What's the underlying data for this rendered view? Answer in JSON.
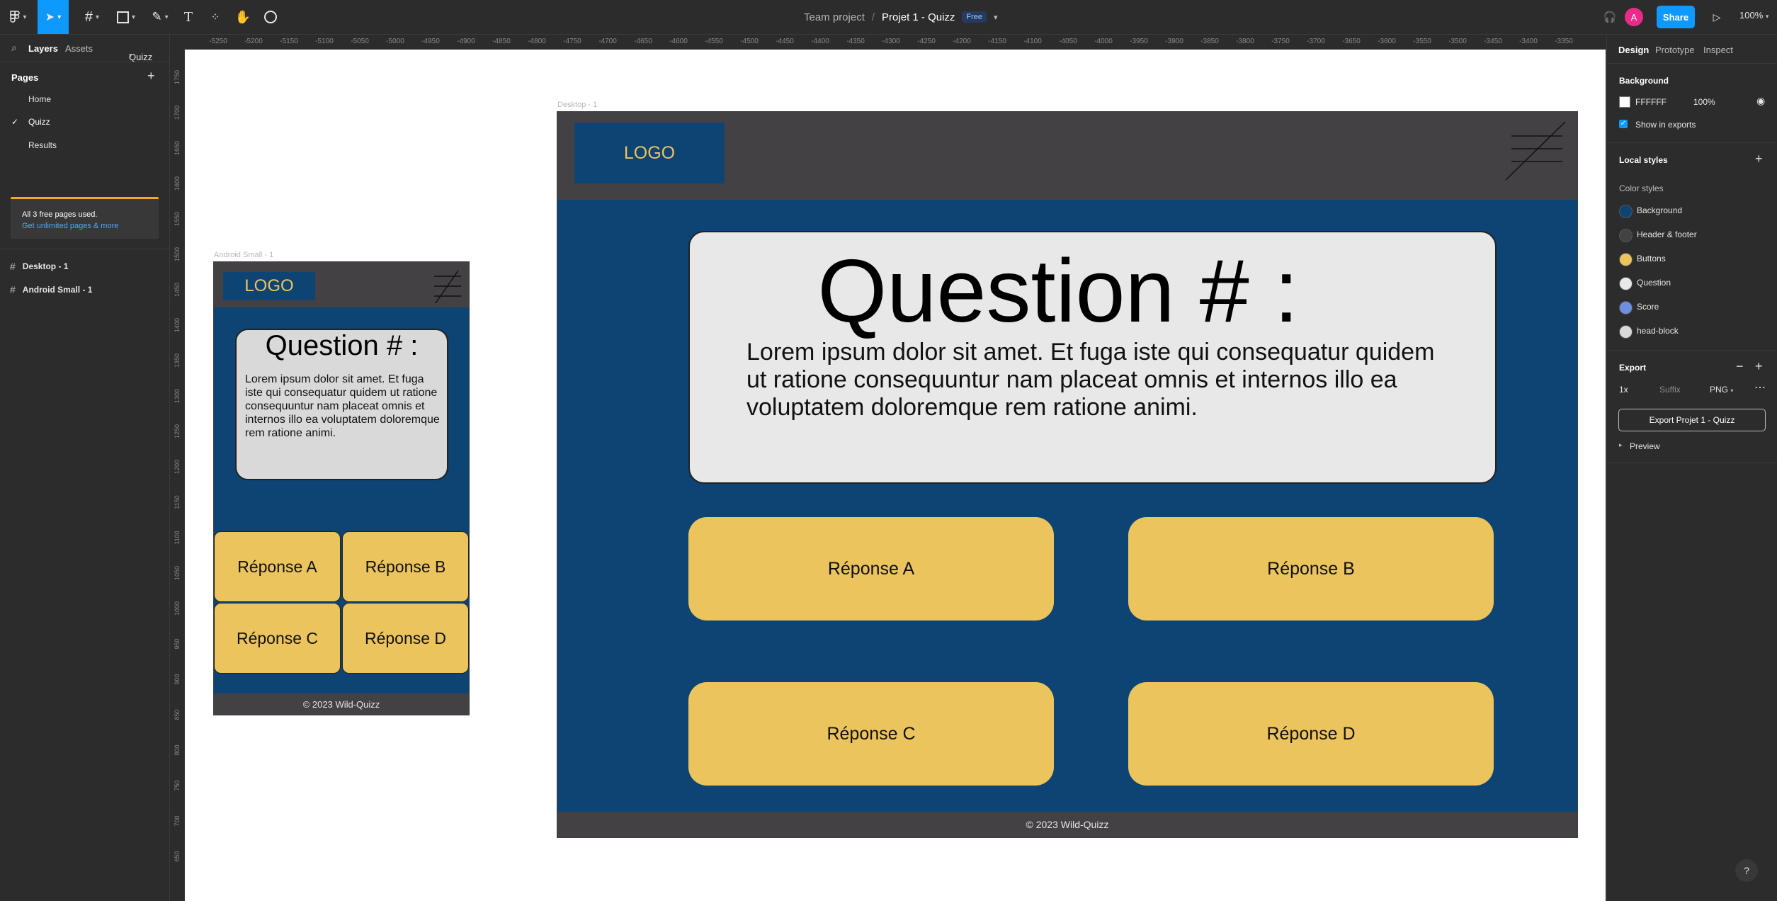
{
  "toolbar": {
    "breadcrumb_team": "Team project",
    "breadcrumb_sep": "/",
    "file_name": "Projet 1 - Quizz",
    "plan_badge": "Free",
    "avatar_initial": "A",
    "share_label": "Share",
    "zoom": "100%"
  },
  "left_panel": {
    "tabs": {
      "layers": "Layers",
      "assets": "Assets",
      "page_selector": "Quizz"
    },
    "pages_title": "Pages",
    "pages": [
      "Home",
      "Quizz",
      "Results"
    ],
    "current_page": "Quizz",
    "banner": {
      "line1": "All 3 free pages used.",
      "link": "Get unlimited pages & more"
    },
    "layers": [
      "Desktop - 1",
      "Android Small - 1"
    ]
  },
  "rulers": {
    "top": [
      "-5250",
      "-5200",
      "-5150",
      "-5100",
      "-5050",
      "-5000",
      "-4950",
      "-4900",
      "-4850",
      "-4800",
      "-4750",
      "-4700",
      "-4650",
      "-4600",
      "-4550",
      "-4500",
      "-4450",
      "-4400",
      "-4350",
      "-4300",
      "-4250",
      "-4200",
      "-4150",
      "-4100",
      "-4050",
      "-4000",
      "-3950",
      "-3900",
      "-3850",
      "-3800",
      "-3750",
      "-3700",
      "-3650",
      "-3600",
      "-3550",
      "-3500",
      "-3450",
      "-3400",
      "-3350"
    ],
    "left": [
      "1750",
      "1700",
      "1650",
      "1600",
      "1550",
      "1500",
      "1450",
      "1400",
      "1350",
      "1300",
      "1250",
      "1200",
      "1150",
      "1100",
      "1050",
      "1000",
      "950",
      "900",
      "850",
      "800",
      "750",
      "700",
      "650"
    ]
  },
  "desktop_frame": {
    "label": "Desktop - 1",
    "logo": "LOGO",
    "question_title": "Question # :",
    "question_text": "Lorem ipsum dolor sit amet. Et fuga iste qui consequatur quidem ut ratione consequuntur nam placeat omnis et internos illo ea voluptatem doloremque rem ratione animi.",
    "answers": [
      "Réponse A",
      "Réponse B",
      "Réponse C",
      "Réponse D"
    ],
    "footer": "© 2023  Wild-Quizz"
  },
  "android_frame": {
    "label": "Android Small - 1",
    "logo": "LOGO",
    "question_title": "Question # :",
    "question_text": "Lorem ipsum dolor sit amet. Et fuga iste qui consequatur quidem ut ratione consequuntur nam placeat omnis et internos illo ea voluptatem doloremque rem ratione animi.",
    "answers": [
      "Réponse A",
      "Réponse B",
      "Réponse C",
      "Réponse D"
    ],
    "footer": "© 2023  Wild-Quizz"
  },
  "right_panel": {
    "tabs": {
      "design": "Design",
      "prototype": "Prototype",
      "inspect": "Inspect"
    },
    "background": {
      "title": "Background",
      "hex": "FFFFFF",
      "opacity": "100%",
      "show_in_exports": "Show in exports"
    },
    "local_styles": {
      "title": "Local styles",
      "color_styles_title": "Color styles",
      "styles": [
        {
          "name": "Background",
          "color": "#0d4473"
        },
        {
          "name": "Header & footer",
          "color": "#444145"
        },
        {
          "name": "Buttons",
          "color": "#ecc45e"
        },
        {
          "name": "Question",
          "color": "#e8e8e8"
        },
        {
          "name": "Score",
          "color": "#6f8fe0"
        },
        {
          "name": "head-block",
          "color": "#d9d9d9"
        }
      ]
    },
    "export": {
      "title": "Export",
      "scale": "1x",
      "suffix_placeholder": "Suffix",
      "format": "PNG",
      "button": "Export Projet 1 - Quizz",
      "preview": "Preview"
    }
  },
  "help_label": "?",
  "colors": {
    "accent": "#0d99ff",
    "frame_background": "#0d4473",
    "header_footer": "#444145",
    "buttons": "#ecc45e"
  }
}
